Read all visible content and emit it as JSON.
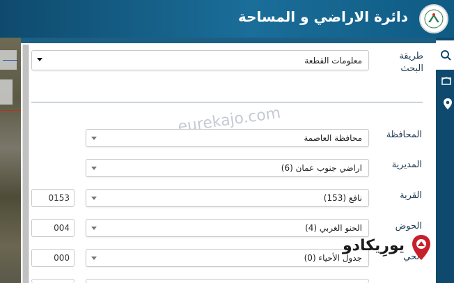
{
  "header": {
    "title": "دائرة الاراضي و المساحة",
    "logo_icon": "dls-emblem-icon"
  },
  "sidebar": {
    "items": [
      {
        "icon": "search-icon"
      },
      {
        "icon": "parcel-icon"
      },
      {
        "icon": "location-pin-icon"
      }
    ]
  },
  "form": {
    "search_method": {
      "label": "طريقة البحث",
      "value": "معلومات القطعة"
    },
    "governorate": {
      "label": "المحافظة",
      "value": "محافظة العاصمة"
    },
    "directorate": {
      "label": "المديرية",
      "value": "اراضي جنوب عمان (6)"
    },
    "village": {
      "label": "القرية",
      "value": "نافع (153)",
      "code": "0153"
    },
    "basin": {
      "label": "الحوض",
      "value": "الحنو الغربي (4)",
      "code": "004"
    },
    "neighborhood": {
      "label": "الحي",
      "value": "جدول الأحياء (0)",
      "code": "000"
    }
  },
  "watermark": "eurekajo.com",
  "brand": {
    "name": "يورِيكادو"
  },
  "colors": {
    "header": "#1a6e99",
    "brand_red": "#c8202b"
  }
}
